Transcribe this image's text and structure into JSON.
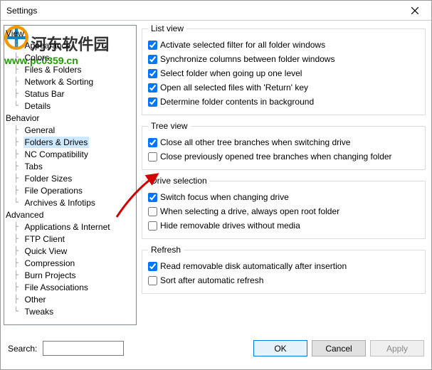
{
  "window": {
    "title": "Settings"
  },
  "tree": {
    "view": "View",
    "appearance": "Appearance",
    "colors": "Colors",
    "files_folders": "Files & Folders",
    "network_sorting": "Network & Sorting",
    "status_bar": "Status Bar",
    "details": "Details",
    "behavior": "Behavior",
    "general": "General",
    "folders_drives": "Folders & Drives",
    "nc_compat": "NC Compatibility",
    "tabs": "Tabs",
    "folder_sizes": "Folder Sizes",
    "file_ops": "File Operations",
    "archives_infotips": "Archives & Infotips",
    "advanced": "Advanced",
    "apps_internet": "Applications & Internet",
    "ftp_client": "FTP Client",
    "quick_view": "Quick View",
    "compression": "Compression",
    "burn_projects": "Burn Projects",
    "file_assoc": "File Associations",
    "other": "Other",
    "tweaks": "Tweaks"
  },
  "groups": {
    "list_view": {
      "title": "List view",
      "activate_filter": "Activate selected filter for all folder windows",
      "sync_cols": "Synchronize columns between folder windows",
      "select_parent": "Select folder when going up one level",
      "open_return": "Open all selected files with 'Return' key",
      "bg_contents": "Determine folder contents in background"
    },
    "tree_view": {
      "title": "Tree view",
      "close_switch": "Close all other tree branches when switching drive",
      "close_change": "Close previously opened tree branches when changing folder"
    },
    "drive_sel": {
      "title": "Drive selection",
      "switch_focus": "Switch focus when changing drive",
      "open_root": "When selecting a drive, always open root folder",
      "hide_removable": "Hide removable drives without media"
    },
    "refresh": {
      "title": "Refresh",
      "read_auto": "Read removable disk automatically after insertion",
      "sort_after": "Sort after automatic refresh"
    }
  },
  "search_label": "Search:",
  "buttons": {
    "ok": "OK",
    "cancel": "Cancel",
    "apply": "Apply"
  },
  "watermark": {
    "text": "河东软件园",
    "url": "www.pc0359.cn"
  },
  "colors": {
    "accent": "#0078d7",
    "arrow": "#d40000"
  }
}
